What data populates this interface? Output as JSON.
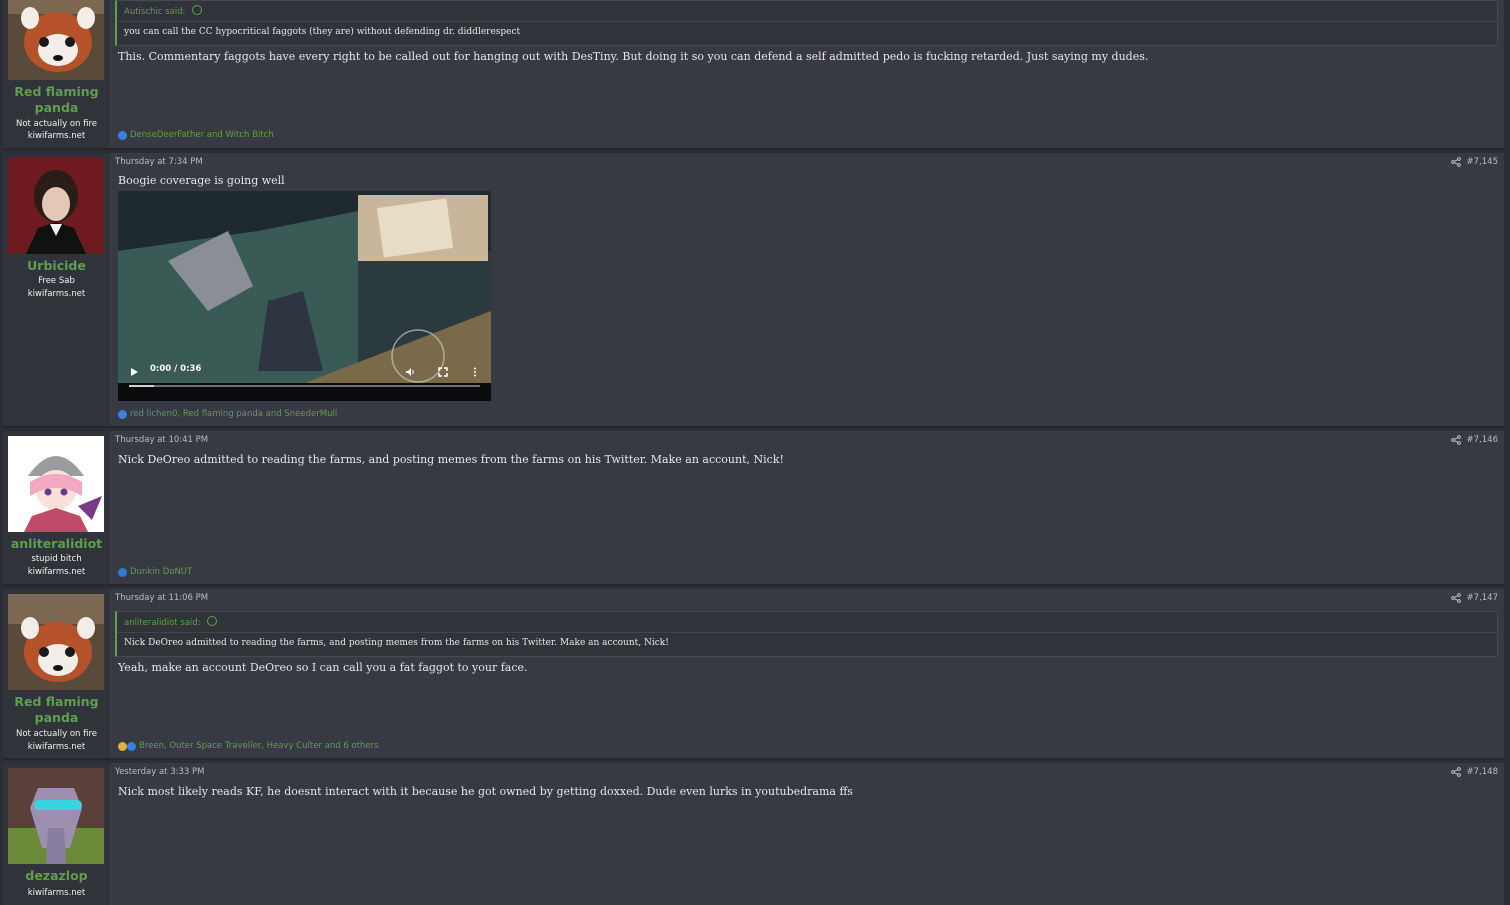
{
  "posts": [
    {
      "username": "Red flaming panda",
      "user_title": "Not actually on fire",
      "user_banner": "kiwifarms.net",
      "avatar": "red-panda-avatar",
      "quote": {
        "author": "Autischic said:",
        "text": "you can call the CC hypocritical faggots (they are) without defending dr. diddlerespect"
      },
      "message": "This. Commentary faggots have every right to be called out for hanging out with DesTiny. But doing it so you can defend a self admitted pedo is fucking retarded. Just saying my dudes.",
      "reactions": "DenseDeerFather and Witch Bitch",
      "reaction_icons": [
        "like-reaction-icon"
      ]
    },
    {
      "date": "Thursday at 7:34 PM",
      "post_number": "#7,145",
      "username": "Urbicide",
      "user_title": "Free Sab",
      "user_banner": "kiwifarms.net",
      "avatar": "urbicide-avatar",
      "message": "Boogie coverage is going well",
      "video": {
        "time": "0:00 / 0:36",
        "progress": 0.07
      },
      "reactions": "red lichen0, Red flaming panda and SneederMull",
      "reaction_icons": [
        "like-reaction-icon"
      ]
    },
    {
      "date": "Thursday at 10:41 PM",
      "post_number": "#7,146",
      "username": "anliteralidiot",
      "user_title": "stupid bitch",
      "user_banner": "kiwifarms.net",
      "avatar": "anime-girl-avatar",
      "message": "Nick DeOreo admitted to reading the farms, and posting memes from the farms on his Twitter. Make an account, Nick!",
      "reactions": "Dunkin DoNUT",
      "reaction_icons": [
        "informative-reaction-icon"
      ]
    },
    {
      "date": "Thursday at 11:06 PM",
      "post_number": "#7,147",
      "username": "Red flaming panda",
      "user_title": "Not actually on fire",
      "user_banner": "kiwifarms.net",
      "avatar": "red-panda-avatar",
      "quote": {
        "author": "anliteralidiot said:",
        "text": "Nick DeOreo admitted to reading the farms, and posting memes from the farms on his Twitter. Make an account, Nick!"
      },
      "message": "Yeah, make an account DeOreo so I can call you a fat faggot to your face.",
      "reactions": "Breen, Outer Space Traveller, Heavy Culter and 6 others",
      "reaction_icons": [
        "winner-reaction-icon",
        "like-reaction-icon"
      ]
    },
    {
      "date": "Yesterday at 3:33 PM",
      "post_number": "#7,148",
      "username": "dezazlop",
      "user_banner": "kiwifarms.net",
      "avatar": "robot-avatar",
      "message": "Nick most likely reads KF, he doesnt interact with it because he got owned by getting doxxed. Dude even lurks in youtubedrama ffs"
    }
  ],
  "colors": {
    "accent_green": "#5f9e4f",
    "post_bg": "#373a42",
    "user_cell_bg": "#30333a",
    "page_bg": "#2b2e34"
  }
}
